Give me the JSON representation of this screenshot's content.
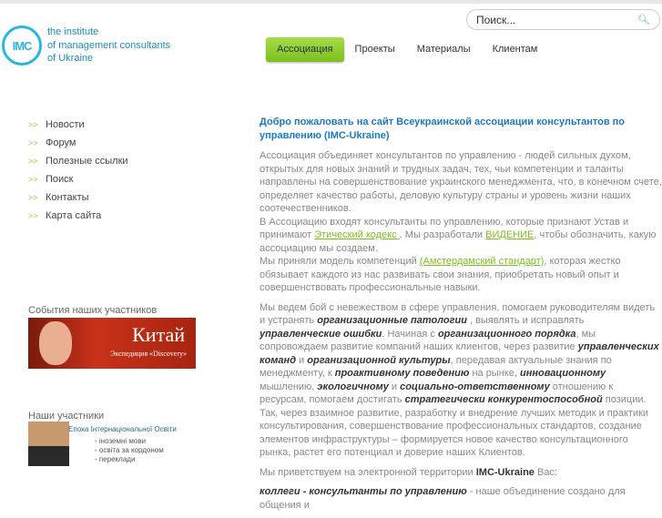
{
  "header": {
    "logo_mark": "IMC",
    "logo_lines": [
      "the institute",
      "of management consultants",
      "of Ukraine"
    ],
    "search_placeholder": "Поиск...",
    "search_icon": "magnifier-icon"
  },
  "nav": [
    "Ассоциация",
    "Проекты",
    "Материалы",
    "Клиентам"
  ],
  "sidebar": {
    "arrow": ">>",
    "items": [
      "Новости",
      "Форум",
      "Полезные ссылки",
      "Поиск",
      "Контакты",
      "Карта сайта"
    ]
  },
  "events": {
    "title": "События наших участников",
    "banner_title": "Китай",
    "banner_sub": "Экспедиция «Discovery»"
  },
  "members": {
    "title": "Наши участники",
    "name": "Епоха Інтернаціональної Освіти",
    "items": [
      "- іноземні мови",
      "- освіта за кордоном",
      "- переклади"
    ]
  },
  "content": {
    "heading": "Добро пожаловать на сайт Всеукраинской ассоциации консультантов по управлению (IMC-Ukraine)",
    "paragraphs": [
      {
        "tight": true,
        "segs": [
          {
            "t": "Ассоциация объединяет консультантов по управлению  - людей сильных духом, открытых для  новых знаний и трудных задач, тех,  чьи компетенции  и таланты направлены на совершенствование украинского менеджмента, что, в конечном счете, определяет качество работы, деловую культуру страны и уровень жизни наших соотечественников."
          }
        ]
      },
      {
        "tight": true,
        "segs": [
          {
            "t": "В Ассоциацию входят  консультанты по управлению, которые признают Устав и принимают "
          },
          {
            "t": "Этический кодекс ",
            "s": "a"
          },
          {
            "t": ". Мы разработали  "
          },
          {
            "t": "ВИДЕНИЕ",
            "s": "a"
          },
          {
            "t": ", чтобы  обозначить, какую ассоциацию мы создаем."
          }
        ]
      },
      {
        "segs": [
          {
            "t": "Мы приняли модель компетенций  "
          },
          {
            "t": "(Амстердамский стандарт)",
            "s": "a"
          },
          {
            "t": ", которая жестко обязывает каждого из нас развивать свои  знания, приобретать новый опыт и совершенствовать профессиональные навыки."
          }
        ]
      },
      {
        "tight": true,
        "segs": [
          {
            "t": "Мы ведем бой  с невежеством в сфере управления, помогаем  руководителям видеть и устранять "
          },
          {
            "t": "организационные патологии",
            "s": "b"
          },
          {
            "t": " , выявлять  и исправлять  "
          },
          {
            "t": "управленческие ошибки",
            "s": "b"
          },
          {
            "t": ". Начиная с  "
          },
          {
            "t": "организационного порядка",
            "s": "b"
          },
          {
            "t": ", мы сопровождаем развитие компаний наших клиентов, через развитие "
          },
          {
            "t": "управленческих команд",
            "s": "b"
          },
          {
            "t": " и "
          },
          {
            "t": "организационной культуры",
            "s": "b"
          },
          {
            "t": ", передавая актуальные знания по менеджменту, к  "
          },
          {
            "t": "проактивному поведению",
            "s": "b"
          },
          {
            "t": " на рынке, "
          },
          {
            "t": "инновационному",
            "s": "b"
          },
          {
            "t": " мышлению,  "
          },
          {
            "t": "экологичному",
            "s": "b"
          },
          {
            "t": " и  "
          },
          {
            "t": "социально-ответственному",
            "s": "b"
          },
          {
            "t": " отношению к ресурсам, помогаем достигать  "
          },
          {
            "t": "стратегически конкурентоспособной",
            "s": "b"
          },
          {
            "t": " позиции."
          }
        ]
      },
      {
        "segs": [
          {
            "t": "Так, через взаимное  развитие, разработку и внедрение лучших методик и практики консультирования, совершенствование профессиональных стандартов, создание элементов инфраструктуры – формируется новое качество  консультационного рынка, растет его потенциал и доверие наших Клиентов."
          }
        ]
      },
      {
        "segs": [
          {
            "t": "Мы приветствуем на электронной территории "
          },
          {
            "t": "IMC-Ukraine",
            "s": "s"
          },
          {
            "t": " Вас:"
          }
        ]
      },
      {
        "segs": [
          {
            "t": "коллеги - консультанты по управлению",
            "s": "b"
          },
          {
            "t": "  - наше объединение создано  для общения и"
          }
        ]
      }
    ]
  }
}
